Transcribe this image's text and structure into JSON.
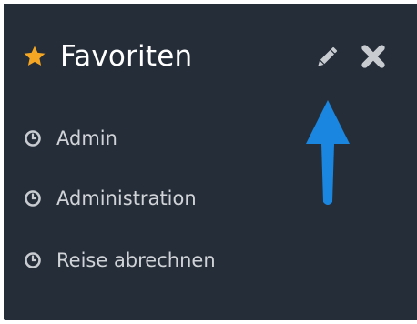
{
  "panel": {
    "title": "Favoriten",
    "icons": {
      "title": "star-icon",
      "edit": "pencil-icon",
      "close": "close-icon",
      "item": "clock-icon",
      "annotation": "arrow-up-icon"
    },
    "items": [
      {
        "label": "Admin"
      },
      {
        "label": "Administration"
      },
      {
        "label": "Reise abrechnen"
      }
    ]
  },
  "colors": {
    "panel_background": "#252d38",
    "star": "#f5a623",
    "title_text": "#ffffff",
    "item_text": "#d0d3d7",
    "icon_gray": "#c8ccd1",
    "annotation_arrow": "#1a86e0"
  }
}
